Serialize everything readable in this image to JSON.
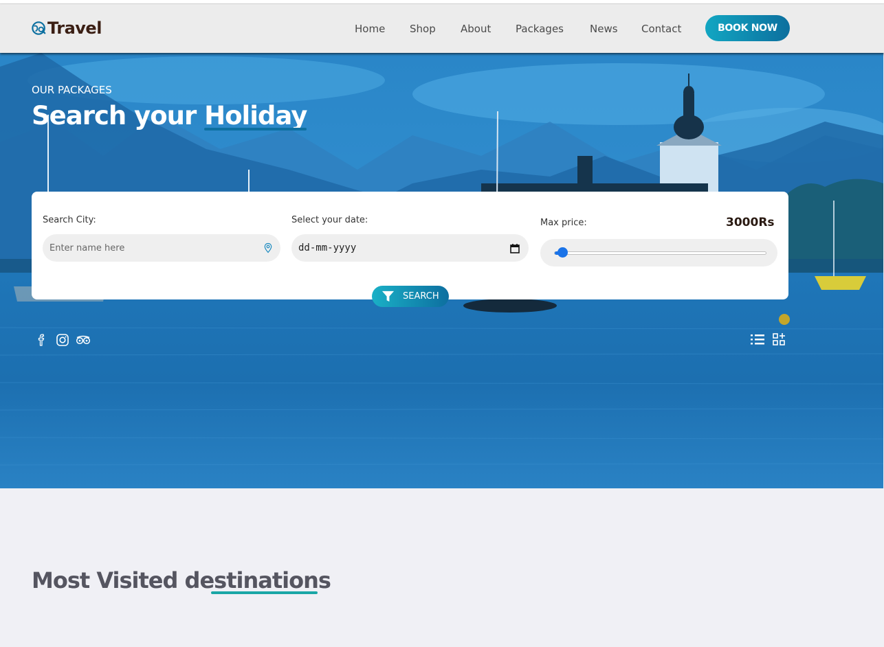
{
  "brand": {
    "name": "Travel",
    "logo_icon": "globe-search-icon"
  },
  "nav": {
    "links": [
      "Home",
      "Shop",
      "About",
      "Packages",
      "News",
      "Contact"
    ],
    "cta_label": "BOOK NOW"
  },
  "hero": {
    "kicker": "OUR PACKAGES",
    "title_part1": "Search your ",
    "title_highlight": "Holiday"
  },
  "search": {
    "city_label": "Search City:",
    "city_placeholder": "Enter name here",
    "date_label": "Select your date:",
    "date_value": "dd-mm-yyyy",
    "price_label": "Max price:",
    "price_value": "3000Rs",
    "price_slider_fraction": 0.04,
    "button_label": "SEARCH"
  },
  "social_icons": [
    "facebook-icon",
    "instagram-icon",
    "tripadvisor-icon"
  ],
  "view_icons": [
    "list-view-icon",
    "grid-view-icon"
  ],
  "destinations": {
    "title_part1": "Most Visited des",
    "title_part2": "tinations"
  },
  "colors": {
    "accent": "#12a6c2",
    "accent_dark": "#0c6f9e",
    "slider": "#1a73e8",
    "heading_dark": "#3b1f14"
  }
}
